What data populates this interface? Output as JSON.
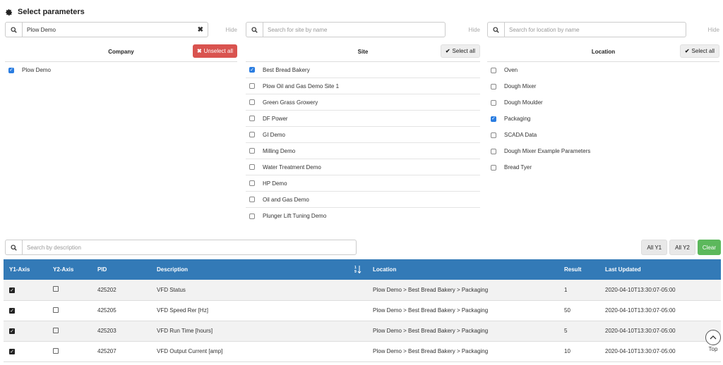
{
  "header": {
    "title": "Select parameters",
    "icon": "gear-icon"
  },
  "company": {
    "search_value": "Plow Demo",
    "hide_label": "Hide",
    "column_label": "Company",
    "action_label": "Unselect all",
    "items": [
      {
        "label": "Plow Demo",
        "checked": true
      }
    ]
  },
  "site": {
    "search_placeholder": "Search for site by name",
    "hide_label": "Hide",
    "column_label": "Site",
    "action_label": "Select all",
    "items": [
      {
        "label": "Best Bread Bakery",
        "checked": true
      },
      {
        "label": "Plow Oil and Gas Demo Site 1",
        "checked": false
      },
      {
        "label": "Green Grass Growery",
        "checked": false
      },
      {
        "label": "DF Power",
        "checked": false
      },
      {
        "label": "GI Demo",
        "checked": false
      },
      {
        "label": "Milling Demo",
        "checked": false
      },
      {
        "label": "Water Treatment Demo",
        "checked": false
      },
      {
        "label": "HP Demo",
        "checked": false
      },
      {
        "label": "Oil and Gas Demo",
        "checked": false
      },
      {
        "label": "Plunger Lift Tuning Demo",
        "checked": false
      }
    ]
  },
  "location": {
    "search_placeholder": "Search for location by name",
    "hide_label": "Hide",
    "column_label": "Location",
    "action_label": "Select all",
    "items": [
      {
        "label": "Oven",
        "checked": false
      },
      {
        "label": "Dough Mixer",
        "checked": false
      },
      {
        "label": "Dough Moulder",
        "checked": false
      },
      {
        "label": "Packaging",
        "checked": true
      },
      {
        "label": "SCADA Data",
        "checked": false
      },
      {
        "label": "Dough Mixer Example Parameters",
        "checked": false
      },
      {
        "label": "Bread Tyer",
        "checked": false
      }
    ]
  },
  "description_search": {
    "placeholder": "Search by description"
  },
  "axis_buttons": {
    "all_y1": "All Y1",
    "all_y2": "All Y2",
    "clear": "Clear"
  },
  "table": {
    "headers": {
      "y1": "Y1-Axis",
      "y2": "Y2-Axis",
      "pid": "PID",
      "description": "Description",
      "location": "Location",
      "result": "Result",
      "last_updated": "Last Updated"
    },
    "rows": [
      {
        "y1": true,
        "y2": false,
        "pid": "425202",
        "description": "VFD Status",
        "location": "Plow Demo > Best Bread Bakery > Packaging",
        "result": "1",
        "last_updated": "2020-04-10T13:30:07-05:00"
      },
      {
        "y1": true,
        "y2": false,
        "pid": "425205",
        "description": "VFD Speed Rer [Hz]",
        "location": "Plow Demo > Best Bread Bakery > Packaging",
        "result": "50",
        "last_updated": "2020-04-10T13:30:07-05:00"
      },
      {
        "y1": true,
        "y2": false,
        "pid": "425203",
        "description": "VFD Run Time [hours]",
        "location": "Plow Demo > Best Bread Bakery > Packaging",
        "result": "5",
        "last_updated": "2020-04-10T13:30:07-05:00"
      },
      {
        "y1": true,
        "y2": false,
        "pid": "425207",
        "description": "VFD Output Current [amp]",
        "location": "Plow Demo > Best Bread Bakery > Packaging",
        "result": "10",
        "last_updated": "2020-04-10T13:30:07-05:00"
      }
    ]
  },
  "top_button": {
    "label": "Top"
  },
  "colors": {
    "accent": "#337ab7",
    "danger": "#d9534f",
    "success": "#5cb85c",
    "checkbox": "#2a7de1"
  }
}
